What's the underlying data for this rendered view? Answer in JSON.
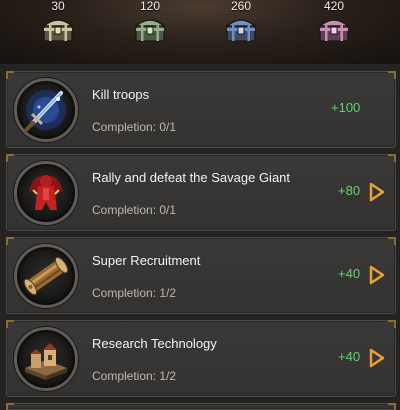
{
  "milestones": [
    {
      "points": "30",
      "chest_color": "#c9c39a",
      "icon": "chest-icon"
    },
    {
      "points": "120",
      "chest_color": "#8fb08a",
      "icon": "chest-icon"
    },
    {
      "points": "260",
      "chest_color": "#6f8fc8",
      "icon": "chest-icon"
    },
    {
      "points": "420",
      "chest_color": "#c88fb4",
      "icon": "chest-icon"
    }
  ],
  "tasks": [
    {
      "title": "Kill troops",
      "completion": "Completion: 0/1",
      "reward": "+100",
      "icon": "sword-icon",
      "has_go": false
    },
    {
      "title": "Rally and defeat the Savage Giant",
      "completion": "Completion: 0/1",
      "reward": "+80",
      "icon": "savage-giant-icon",
      "has_go": true
    },
    {
      "title": "Super Recruitment",
      "completion": "Completion: 1/2",
      "reward": "+40",
      "icon": "scroll-icon",
      "has_go": true
    },
    {
      "title": "Research Technology",
      "completion": "Completion: 1/2",
      "reward": "+40",
      "icon": "academy-building-icon",
      "has_go": true
    }
  ],
  "colors": {
    "reward_green": "#62d46a",
    "go_arrow": "#e8a13a"
  }
}
